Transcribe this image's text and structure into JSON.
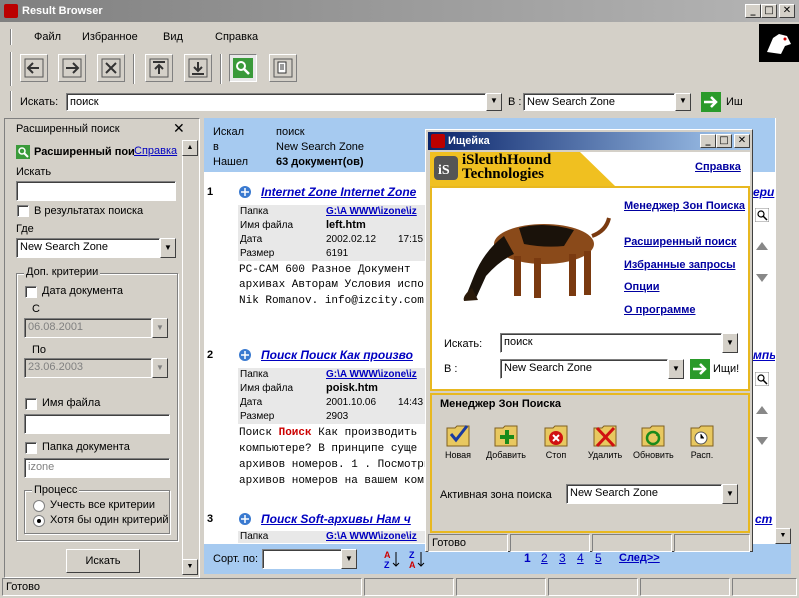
{
  "window": {
    "title": "Result Browser"
  },
  "menu": {
    "file": "Файл",
    "favorites": "Избранное",
    "view": "Вид",
    "help": "Справка"
  },
  "search_bar": {
    "label": "Искать:",
    "value": "поиск",
    "in_label": "В :",
    "zone": "New Search Zone",
    "go_label": "Иш"
  },
  "sidebar": {
    "title": "Расширенный поиск",
    "subtitle": "Расширенный пои",
    "help_link": "Справка",
    "search_label": "Искать",
    "search_value": "",
    "in_results_label": "В результатах поиска",
    "where_label": "Где",
    "where_value": "New Search Zone",
    "extra_criteria_label": "Доп. критерии",
    "doc_date_label": "Дата документа",
    "from_label": "С",
    "from_value": "06.08.2001",
    "to_label": "По",
    "to_value": "23.06.2003",
    "filename_label": "Имя файла",
    "filename_value": "",
    "folder_label": "Папка документа",
    "folder_value": "izone",
    "process_label": "Процесс",
    "all_criteria_label": "Учесть все критерии",
    "any_criteria_label": "Хотя бы один критерий",
    "search_button": "Искать"
  },
  "results_header": {
    "searched_label": "Искал",
    "searched_value": "поиск",
    "in_label": "в",
    "in_value": "New Search Zone",
    "found_label": "Нашел",
    "found_value": "63 документ(ов)"
  },
  "results": [
    {
      "num": "1",
      "title": "Internet Zone Internet Zone",
      "folder_label": "Папка",
      "folder": "G:\\A WWW\\izone\\iz",
      "file_label": "Имя файла",
      "file": "left.htm",
      "date_label": "Дата",
      "date": "2002.02.12",
      "time": "17:15",
      "size_label": "Размер",
      "size": "6191",
      "snippet1": "PC-CAM 600 Разное Документ",
      "snippet2": "архивах Авторам Условия испо",
      "snippet3": "Nik Romanov. info@izcity.com"
    },
    {
      "num": "2",
      "title": "Поиск Поиск Как произво",
      "folder_label": "Папка",
      "folder": "G:\\A WWW\\izone\\iz",
      "file_label": "Имя файла",
      "file": "poisk.htm",
      "date_label": "Дата",
      "date": "2001.10.06",
      "time": "14:43",
      "size_label": "Размер",
      "size": "2903",
      "snippet1a": "Поиск ",
      "snippet1hl": "Поиск",
      "snippet1b": " Как производить",
      "snippet2": "компьютере? В принципе суще",
      "snippet3": "архивов номеров. 1 . Посмотри",
      "snippet4": "архивов номеров на вашем ком"
    },
    {
      "num": "3",
      "title": "Поиск Soft-архивы Нам ч",
      "folder_label": "Папка",
      "folder": "G:\\A WWW\\izone\\iz"
    }
  ],
  "right_peek": {
    "r1": "ери",
    "r2": "мпь",
    "r3": "ст"
  },
  "bottom": {
    "sort_label": "Сорт. по:",
    "pages": [
      "1",
      "2",
      "3",
      "4",
      "5"
    ],
    "next_label": "След>>"
  },
  "status": {
    "text": "Готово"
  },
  "dialog": {
    "title": "Ищейка",
    "logo_line1": "iSleuthHound",
    "logo_line2": "Technologies",
    "help_link": "Справка",
    "links": [
      "Менеджер Зон Поиска",
      "Расширенный поиск",
      "Избранные запросы",
      "Опции",
      "О программе"
    ],
    "search_label": "Искать:",
    "search_value": "поиск",
    "in_label": "В :",
    "zone_value": "New Search Zone",
    "go_label": "Ищи!",
    "zone_manager_title": "Менеджер Зон Поиска",
    "zone_buttons": [
      "Новая",
      "Добавить",
      "Стоп",
      "Удалить",
      "Обновить",
      "Расп."
    ],
    "active_zone_label": "Активная зона поиска",
    "active_zone_value": "New Search Zone",
    "status": "Готово"
  }
}
